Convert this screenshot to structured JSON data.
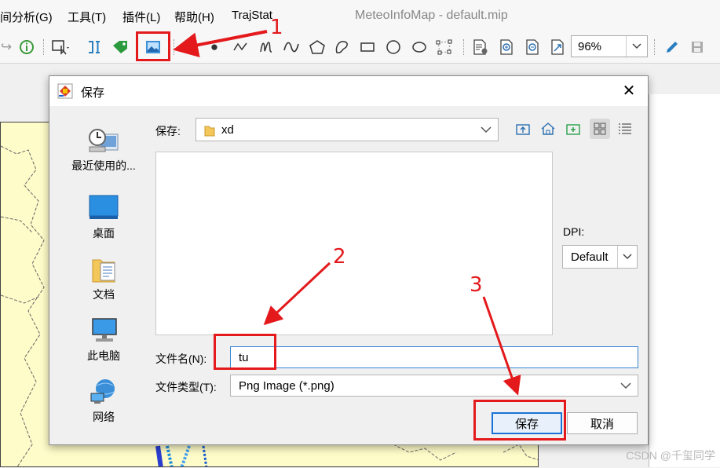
{
  "menubar": {
    "items": [
      {
        "label": "间分析(G)"
      },
      {
        "label": "工具(T)"
      },
      {
        "label": "插件(L)"
      },
      {
        "label": "帮助(H)"
      },
      {
        "label": "TrajStat"
      }
    ],
    "app_title": "MeteoInfoMap - default.mip"
  },
  "toolbar": {
    "zoom": "96%",
    "icons": [
      "identify-icon",
      "select-icon",
      "label-icon",
      "tag-icon",
      "export-image-icon",
      "text-icon",
      "point-icon",
      "polyline-icon",
      "freehand-icon",
      "curve-icon",
      "polygon-icon",
      "curve-polygon-icon",
      "rectangle-icon",
      "circle-icon",
      "ellipse-icon",
      "edit-vertices-icon",
      "page-setup-icon",
      "zoom-in-icon",
      "zoom-out-icon",
      "full-extent-icon",
      "pen-icon",
      "save-icon"
    ]
  },
  "dialog": {
    "title": "保存",
    "places": [
      {
        "label": "最近使用的..."
      },
      {
        "label": "桌面"
      },
      {
        "label": "文档"
      },
      {
        "label": "此电脑"
      },
      {
        "label": "网络"
      }
    ],
    "save_in_label": "保存:",
    "folder": "xd",
    "dpi_label": "DPI:",
    "dpi_value": "Default",
    "filename_label": "文件名(N):",
    "filename_value": "tu",
    "filetype_label": "文件类型(T):",
    "filetype_value": "Png Image (*.png)",
    "save_button": "保存",
    "cancel_button": "取消"
  },
  "annotations": {
    "step1": "1",
    "step2": "2",
    "step3": "3",
    "color": "#e3191c"
  },
  "watermark": "CSDN @千玺同学"
}
